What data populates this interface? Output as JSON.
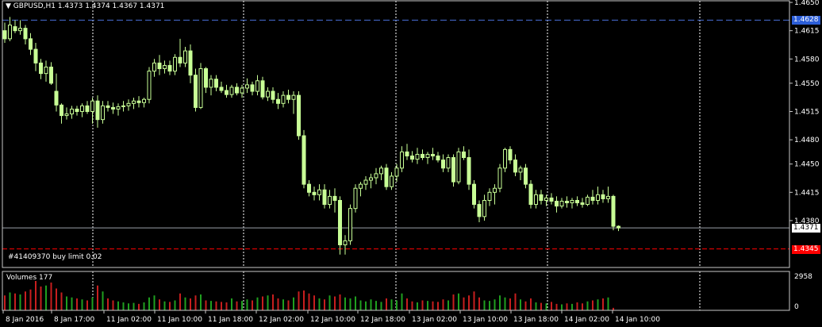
{
  "header": {
    "menu_glyph": "▼",
    "symbol": "GBPUSD,H1",
    "ohlc": "1.4373 1.4374 1.4367 1.4371"
  },
  "order": {
    "label": "#41409370 buy limit 0.02",
    "price_tag": "1.4345",
    "price": 1.4345
  },
  "price_tags": {
    "high_line": "1.4628",
    "current": "1.4371"
  },
  "levels": {
    "high_line": 1.4628,
    "current": 1.4371
  },
  "volumes": {
    "label": "Volumes 177",
    "axis_top": "2958",
    "axis_bottom": "0"
  },
  "colors": {
    "background": "#000000",
    "candle": "#c8ff96",
    "grid": "#ffffff",
    "high_line": "#4a6fd6",
    "order_line": "#ff0000",
    "volume_up": "#1fa01f",
    "volume_down": "#c81e1e"
  },
  "chart_data": {
    "type": "candlestick",
    "ylim": [
      1.4322,
      1.4652
    ],
    "price_ticks": [
      "1.4650",
      "1.4615",
      "1.4580",
      "1.4550",
      "1.4515",
      "1.4480",
      "1.4450",
      "1.4415",
      "1.4380"
    ],
    "price_tick_values": [
      1.465,
      1.4615,
      1.458,
      1.455,
      1.4515,
      1.448,
      1.445,
      1.4415,
      1.438
    ],
    "time_labels": [
      "8 Jan 2016",
      "8 Jan 17:00",
      "11 Jan 02:00",
      "11 Jan 10:00",
      "11 Jan 18:00",
      "12 Jan 02:00",
      "12 Jan 10:00",
      "12 Jan 18:00",
      "13 Jan 02:00",
      "13 Jan 10:00",
      "13 Jan 18:00",
      "14 Jan 02:00",
      "14 Jan 10:00"
    ],
    "vlim": [
      0,
      2958
    ],
    "candles": [
      [
        1.4615,
        1.4625,
        1.46,
        1.4605
      ],
      [
        1.4605,
        1.4632,
        1.4602,
        1.4622
      ],
      [
        1.462,
        1.4628,
        1.4612,
        1.4615
      ],
      [
        1.4615,
        1.4628,
        1.461,
        1.4618
      ],
      [
        1.4618,
        1.4622,
        1.4598,
        1.4605
      ],
      [
        1.4605,
        1.4612,
        1.4585,
        1.4592
      ],
      [
        1.4592,
        1.46,
        1.4565,
        1.4575
      ],
      [
        1.4575,
        1.458,
        1.4555,
        1.4562
      ],
      [
        1.4562,
        1.4578,
        1.4552,
        1.457
      ],
      [
        1.457,
        1.4576,
        1.4548,
        1.455
      ],
      [
        1.454,
        1.4562,
        1.4515,
        1.4523
      ],
      [
        1.4523,
        1.4525,
        1.45,
        1.451
      ],
      [
        1.451,
        1.452,
        1.4505,
        1.4512
      ],
      [
        1.4512,
        1.4522,
        1.4506,
        1.4518
      ],
      [
        1.4518,
        1.4522,
        1.451,
        1.4515
      ],
      [
        1.4515,
        1.4525,
        1.4508,
        1.4522
      ],
      [
        1.4522,
        1.4528,
        1.4512,
        1.4515
      ],
      [
        1.4515,
        1.4532,
        1.45,
        1.4528
      ],
      [
        1.4528,
        1.4535,
        1.4495,
        1.4505
      ],
      [
        1.4505,
        1.4528,
        1.45,
        1.4522
      ],
      [
        1.4522,
        1.4528,
        1.4515,
        1.452
      ],
      [
        1.452,
        1.4526,
        1.4512,
        1.4518
      ],
      [
        1.4518,
        1.4525,
        1.451,
        1.4521
      ],
      [
        1.4521,
        1.4528,
        1.4515,
        1.4522
      ],
      [
        1.4522,
        1.453,
        1.4516,
        1.4525
      ],
      [
        1.4525,
        1.4532,
        1.4518,
        1.4528
      ],
      [
        1.4528,
        1.4534,
        1.452,
        1.4526
      ],
      [
        1.4526,
        1.4532,
        1.452,
        1.453
      ],
      [
        1.453,
        1.457,
        1.4525,
        1.4565
      ],
      [
        1.4565,
        1.458,
        1.4558,
        1.4575
      ],
      [
        1.4575,
        1.4585,
        1.456,
        1.4568
      ],
      [
        1.4568,
        1.4578,
        1.4562,
        1.4572
      ],
      [
        1.4572,
        1.4578,
        1.456,
        1.4565
      ],
      [
        1.4565,
        1.4586,
        1.456,
        1.4582
      ],
      [
        1.4582,
        1.4605,
        1.457,
        1.4575
      ],
      [
        1.4575,
        1.4595,
        1.457,
        1.459
      ],
      [
        1.459,
        1.4598,
        1.455,
        1.456
      ],
      [
        1.456,
        1.4568,
        1.4515,
        1.452
      ],
      [
        1.452,
        1.4575,
        1.4518,
        1.4568
      ],
      [
        1.4568,
        1.457,
        1.4538,
        1.4545
      ],
      [
        1.4545,
        1.456,
        1.4535,
        1.4555
      ],
      [
        1.4555,
        1.456,
        1.454,
        1.4545
      ],
      [
        1.4545,
        1.4552,
        1.4538,
        1.4541
      ],
      [
        1.4541,
        1.4548,
        1.4532,
        1.4536
      ],
      [
        1.4536,
        1.4548,
        1.4532,
        1.4545
      ],
      [
        1.4545,
        1.455,
        1.4535,
        1.4538
      ],
      [
        1.4538,
        1.4548,
        1.4532,
        1.4544
      ],
      [
        1.4544,
        1.4556,
        1.4538,
        1.4548
      ],
      [
        1.4548,
        1.4552,
        1.4535,
        1.454
      ],
      [
        1.454,
        1.456,
        1.4535,
        1.4553
      ],
      [
        1.4553,
        1.4558,
        1.453,
        1.4533
      ],
      [
        1.4533,
        1.4545,
        1.4528,
        1.454
      ],
      [
        1.454,
        1.4545,
        1.4525,
        1.453
      ],
      [
        1.453,
        1.4538,
        1.4518,
        1.4525
      ],
      [
        1.4525,
        1.454,
        1.452,
        1.4535
      ],
      [
        1.4535,
        1.4542,
        1.4525,
        1.453
      ],
      [
        1.453,
        1.454,
        1.4512,
        1.4535
      ],
      [
        1.4535,
        1.454,
        1.448,
        1.4485
      ],
      [
        1.4485,
        1.4492,
        1.442,
        1.4425
      ],
      [
        1.4425,
        1.443,
        1.441,
        1.4415
      ],
      [
        1.4415,
        1.4422,
        1.4405,
        1.4412
      ],
      [
        1.4412,
        1.4425,
        1.4405,
        1.4418
      ],
      [
        1.4418,
        1.4425,
        1.4395,
        1.44
      ],
      [
        1.44,
        1.4418,
        1.4395,
        1.441
      ],
      [
        1.441,
        1.442,
        1.439,
        1.4405
      ],
      [
        1.4405,
        1.441,
        1.4338,
        1.435
      ],
      [
        1.435,
        1.4362,
        1.4338,
        1.4355
      ],
      [
        1.4355,
        1.44,
        1.435,
        1.4395
      ],
      [
        1.4395,
        1.4425,
        1.439,
        1.442
      ],
      [
        1.442,
        1.4428,
        1.441,
        1.4425
      ],
      [
        1.4425,
        1.4435,
        1.4418,
        1.443
      ],
      [
        1.443,
        1.4438,
        1.442,
        1.4433
      ],
      [
        1.4433,
        1.4445,
        1.4425,
        1.4438
      ],
      [
        1.4438,
        1.4448,
        1.443,
        1.4445
      ],
      [
        1.4445,
        1.445,
        1.4418,
        1.4422
      ],
      [
        1.4422,
        1.444,
        1.4418,
        1.4435
      ],
      [
        1.4435,
        1.445,
        1.4428,
        1.4445
      ],
      [
        1.4445,
        1.4472,
        1.444,
        1.4465
      ],
      [
        1.4465,
        1.4475,
        1.4455,
        1.446
      ],
      [
        1.446,
        1.4466,
        1.4452,
        1.4456
      ],
      [
        1.4456,
        1.447,
        1.445,
        1.4462
      ],
      [
        1.4462,
        1.4468,
        1.4455,
        1.4458
      ],
      [
        1.4458,
        1.4465,
        1.445,
        1.4462
      ],
      [
        1.4462,
        1.447,
        1.4455,
        1.446
      ],
      [
        1.446,
        1.4465,
        1.4452,
        1.4455
      ],
      [
        1.4455,
        1.4462,
        1.444,
        1.4445
      ],
      [
        1.4445,
        1.4462,
        1.444,
        1.4458
      ],
      [
        1.4458,
        1.4462,
        1.4422,
        1.4428
      ],
      [
        1.4428,
        1.447,
        1.4425,
        1.4465
      ],
      [
        1.4465,
        1.4472,
        1.4455,
        1.4458
      ],
      [
        1.4458,
        1.4468,
        1.4418,
        1.4425
      ],
      [
        1.4425,
        1.443,
        1.4395,
        1.44
      ],
      [
        1.44,
        1.4405,
        1.4378,
        1.4385
      ],
      [
        1.4385,
        1.4412,
        1.438,
        1.4405
      ],
      [
        1.4405,
        1.442,
        1.4398,
        1.4415
      ],
      [
        1.4415,
        1.4425,
        1.44,
        1.442
      ],
      [
        1.442,
        1.445,
        1.4415,
        1.4445
      ],
      [
        1.4445,
        1.447,
        1.444,
        1.4468
      ],
      [
        1.4468,
        1.4472,
        1.445,
        1.4455
      ],
      [
        1.4455,
        1.4462,
        1.4435,
        1.444
      ],
      [
        1.444,
        1.4448,
        1.443,
        1.4445
      ],
      [
        1.4445,
        1.445,
        1.442,
        1.4425
      ],
      [
        1.4425,
        1.443,
        1.4395,
        1.44
      ],
      [
        1.44,
        1.4418,
        1.4395,
        1.4412
      ],
      [
        1.4412,
        1.4418,
        1.44,
        1.4405
      ],
      [
        1.4405,
        1.4412,
        1.4398,
        1.4408
      ],
      [
        1.4408,
        1.4414,
        1.44,
        1.4404
      ],
      [
        1.4404,
        1.441,
        1.439,
        1.4398
      ],
      [
        1.4398,
        1.4408,
        1.4395,
        1.4404
      ],
      [
        1.4404,
        1.441,
        1.4396,
        1.4402
      ],
      [
        1.4402,
        1.4408,
        1.4395,
        1.4405
      ],
      [
        1.4405,
        1.441,
        1.4398,
        1.4402
      ],
      [
        1.4402,
        1.4408,
        1.4396,
        1.44
      ],
      [
        1.44,
        1.4412,
        1.4398,
        1.4409
      ],
      [
        1.4409,
        1.4418,
        1.44,
        1.4405
      ],
      [
        1.4405,
        1.4422,
        1.44,
        1.4412
      ],
      [
        1.4412,
        1.4418,
        1.4402,
        1.4407
      ],
      [
        1.4407,
        1.4422,
        1.4402,
        1.441
      ],
      [
        1.441,
        1.4412,
        1.4368,
        1.4373
      ],
      [
        1.4373,
        1.4374,
        1.4367,
        1.4371
      ]
    ],
    "volumes": [
      1500,
      1800,
      1700,
      1600,
      1900,
      2100,
      2958,
      2400,
      2500,
      2800,
      2200,
      1800,
      1400,
      1300,
      1200,
      1100,
      1000,
      1300,
      2500,
      1900,
      1200,
      1000,
      900,
      800,
      700,
      750,
      650,
      800,
      1300,
      1500,
      1100,
      900,
      850,
      1000,
      1700,
      1300,
      1200,
      1500,
      1600,
      1000,
      950,
      900,
      850,
      800,
      1200,
      900,
      950,
      1100,
      1000,
      1300,
      1400,
      1500,
      1600,
      1200,
      1100,
      1000,
      1300,
      1900,
      2000,
      1700,
      1500,
      1200,
      1100,
      1500,
      1400,
      1600,
      1300,
      1200,
      1400,
      1000,
      900,
      1100,
      950,
      850,
      1200,
      1100,
      1000,
      1700,
      1200,
      900,
      800,
      1000,
      950,
      900,
      850,
      1100,
      1000,
      1600,
      1700,
      1300,
      1500,
      1900,
      1300,
      1000,
      950,
      1100,
      1500,
      1300,
      1200,
      1700,
      1100,
      900,
      1200,
      800,
      750,
      700,
      850,
      650,
      600,
      700,
      650,
      800,
      700,
      900,
      1000,
      1100,
      1200,
      1300,
      250
    ]
  }
}
